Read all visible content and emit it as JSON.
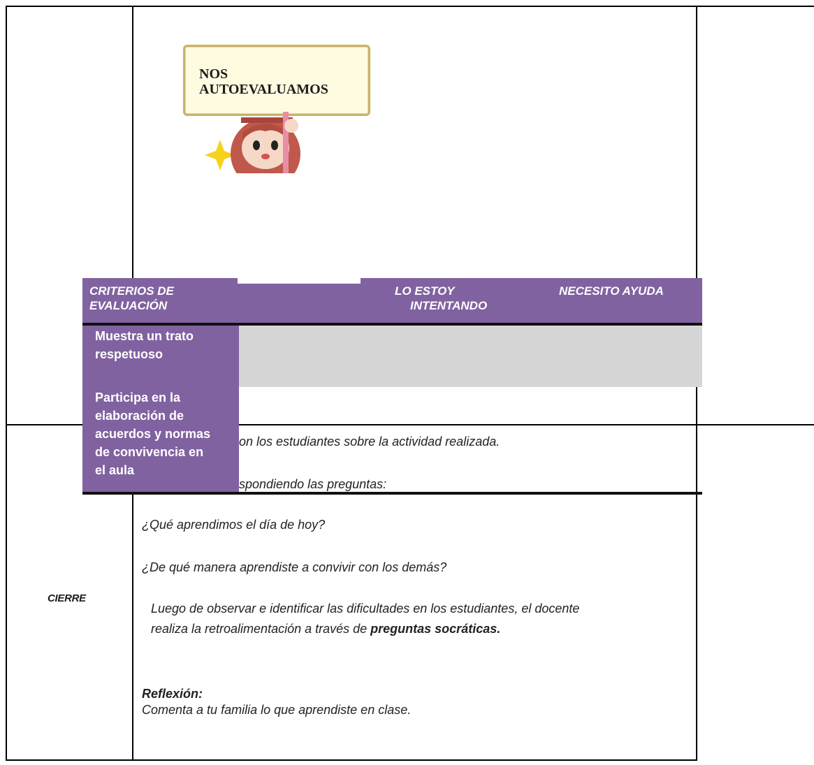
{
  "sign": {
    "line1": "NOS",
    "line2": "AUTOEVALUAMOS"
  },
  "rubric": {
    "headers": {
      "criteria_line1": "CRITERIOS DE",
      "criteria_line2": "EVALUACIÓN",
      "trying_line1": "LO ESTOY",
      "trying_line2": "INTENTANDO",
      "help": "NECESITO AYUDA"
    },
    "criteria": [
      {
        "line1": "Muestra un trato",
        "line2": "respetuoso"
      },
      {
        "line1": "Participa en la",
        "line2": "elaboración de",
        "line3": "acuerdos y normas",
        "line4": "de convivencia en",
        "line5": "el aula"
      }
    ]
  },
  "cierre": {
    "label": "CIERRE",
    "dialog_partial": "on los estudiantes sobre la actividad realizada.",
    "respond_partial": "spondiendo las preguntas:",
    "question1": "¿Qué aprendimos el día de hoy?",
    "question2": "¿De qué manera aprendiste a convivir con los demás?",
    "feedback_line1": "Luego de observar e identificar las dificultades en los estudiantes, el docente",
    "feedback_line2_prefix": "realiza la retroalimentación a través de ",
    "feedback_line2_bold": "preguntas socráticas.",
    "reflection_title": "Reflexión:",
    "reflection_text": "Comenta a tu familia lo que aprendiste en clase."
  }
}
